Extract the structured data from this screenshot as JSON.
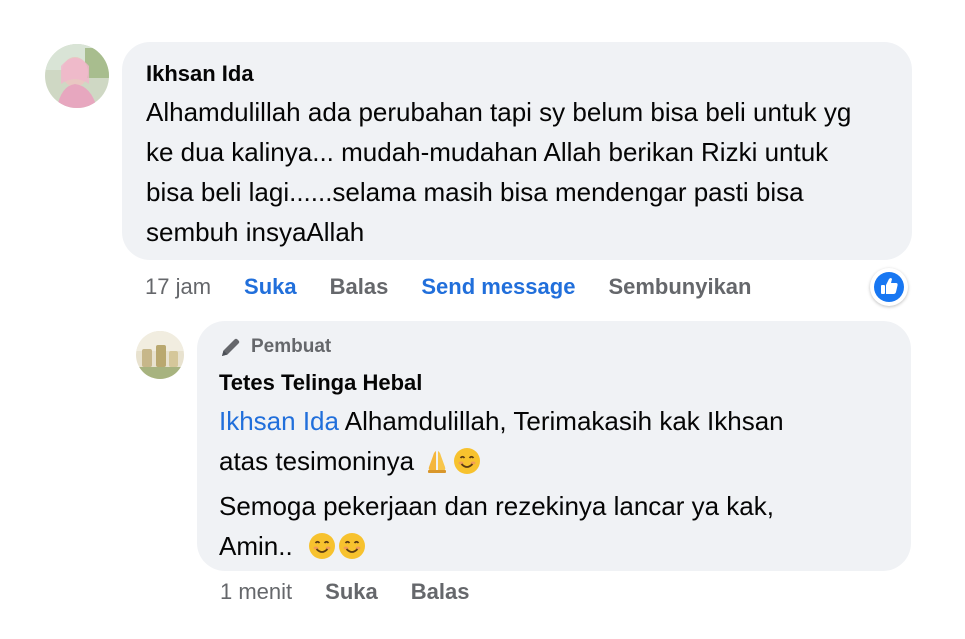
{
  "comment": {
    "author": "Ikhsan Ida",
    "text": "Alhamdulillah ada perubahan tapi sy belum bisa beli untuk yg ke dua kalinya... mudah-mudahan Allah berikan Rizki untuk bisa beli lagi......selama masih bisa mendengar pasti bisa sembuh insyaAllah",
    "time": "17 jam",
    "actions": {
      "like": "Suka",
      "reply": "Balas",
      "send_message": "Send message",
      "hide": "Sembunyikan"
    },
    "reaction_icon": "like-icon"
  },
  "reply": {
    "badge": "Pembuat",
    "badge_icon": "pencil-icon",
    "author": "Tetes Telinga Hebal",
    "mention": "Ikhsan Ida",
    "line1_rest": " Alhamdulillah, Terimakasih kak Ikhsan",
    "line2": "atas tesimoninya",
    "line3": "Semoga pekerjaan dan rezekinya lancar ya kak,",
    "line4": "Amin..",
    "time": "1 menit",
    "actions": {
      "like": "Suka",
      "reply": "Balas"
    }
  },
  "colors": {
    "bubble": "#f0f2f5",
    "link": "#216fdb",
    "secondary_text": "#65676b",
    "like_blue": "#1877f2"
  }
}
